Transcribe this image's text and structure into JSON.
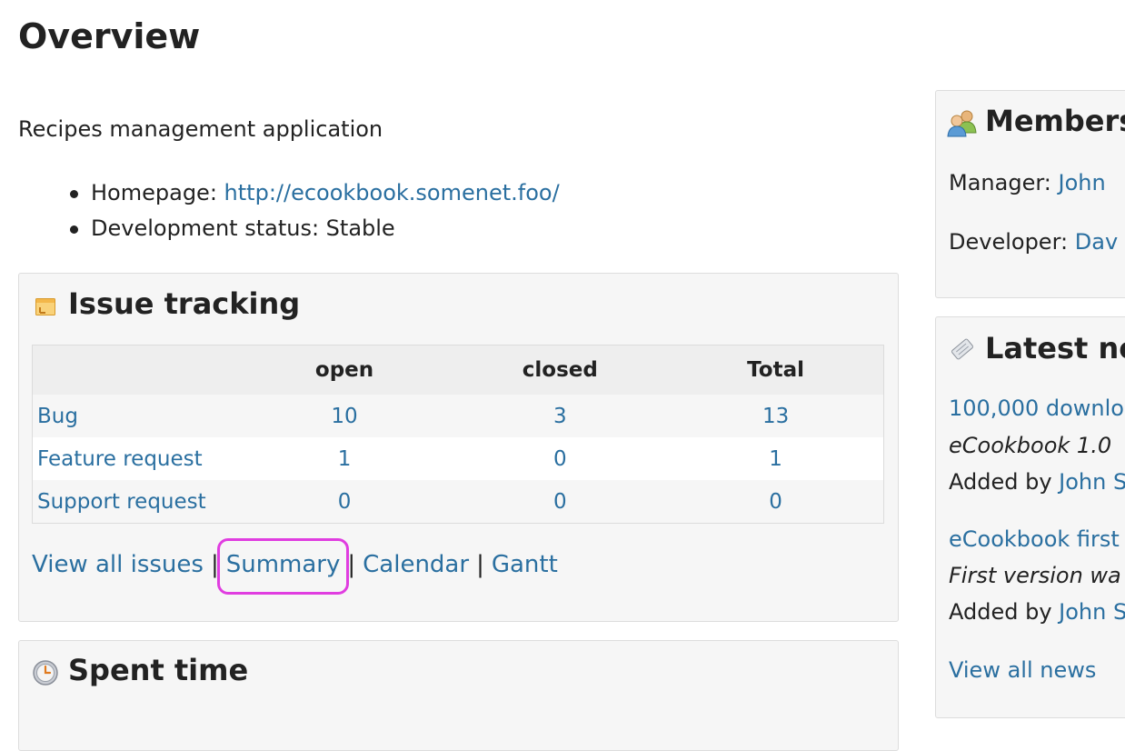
{
  "page": {
    "title": "Overview",
    "description": "Recipes management application"
  },
  "project_info": {
    "homepage_label": "Homepage:",
    "homepage_url": "http://ecookbook.somenet.foo/",
    "status_label": "Development status:",
    "status_value": "Stable"
  },
  "issue_tracking": {
    "title": "Issue tracking",
    "columns": [
      "",
      "open",
      "closed",
      "Total"
    ],
    "rows": [
      {
        "tracker": "Bug",
        "open": "10",
        "closed": "3",
        "total": "13"
      },
      {
        "tracker": "Feature request",
        "open": "1",
        "closed": "0",
        "total": "1"
      },
      {
        "tracker": "Support request",
        "open": "0",
        "closed": "0",
        "total": "0"
      }
    ],
    "links": {
      "view_all": "View all issues",
      "summary": "Summary",
      "calendar": "Calendar",
      "gantt": "Gantt",
      "separator": "|"
    }
  },
  "spent_time": {
    "title": "Spent time"
  },
  "members": {
    "title": "Members",
    "lines": [
      {
        "role": "Manager:",
        "name": "John"
      },
      {
        "role": "Developer:",
        "name": "Dav"
      }
    ]
  },
  "latest_news": {
    "title": "Latest ne",
    "items": [
      {
        "title": "100,000 downlo",
        "summary": "eCookbook 1.0",
        "added_by": "Added by",
        "author": "John S"
      },
      {
        "title": "eCookbook first",
        "summary": "First version wa",
        "added_by": "Added by",
        "author": "John S"
      }
    ],
    "view_all": "View all news"
  },
  "colors": {
    "link": "#2a6fa0",
    "highlight": "#e03de0",
    "box_bg": "#f6f6f6"
  },
  "icons": {
    "issue_tracking": "issues-icon",
    "spent_time": "clock-icon",
    "members": "group-icon",
    "latest_news": "news-icon"
  }
}
